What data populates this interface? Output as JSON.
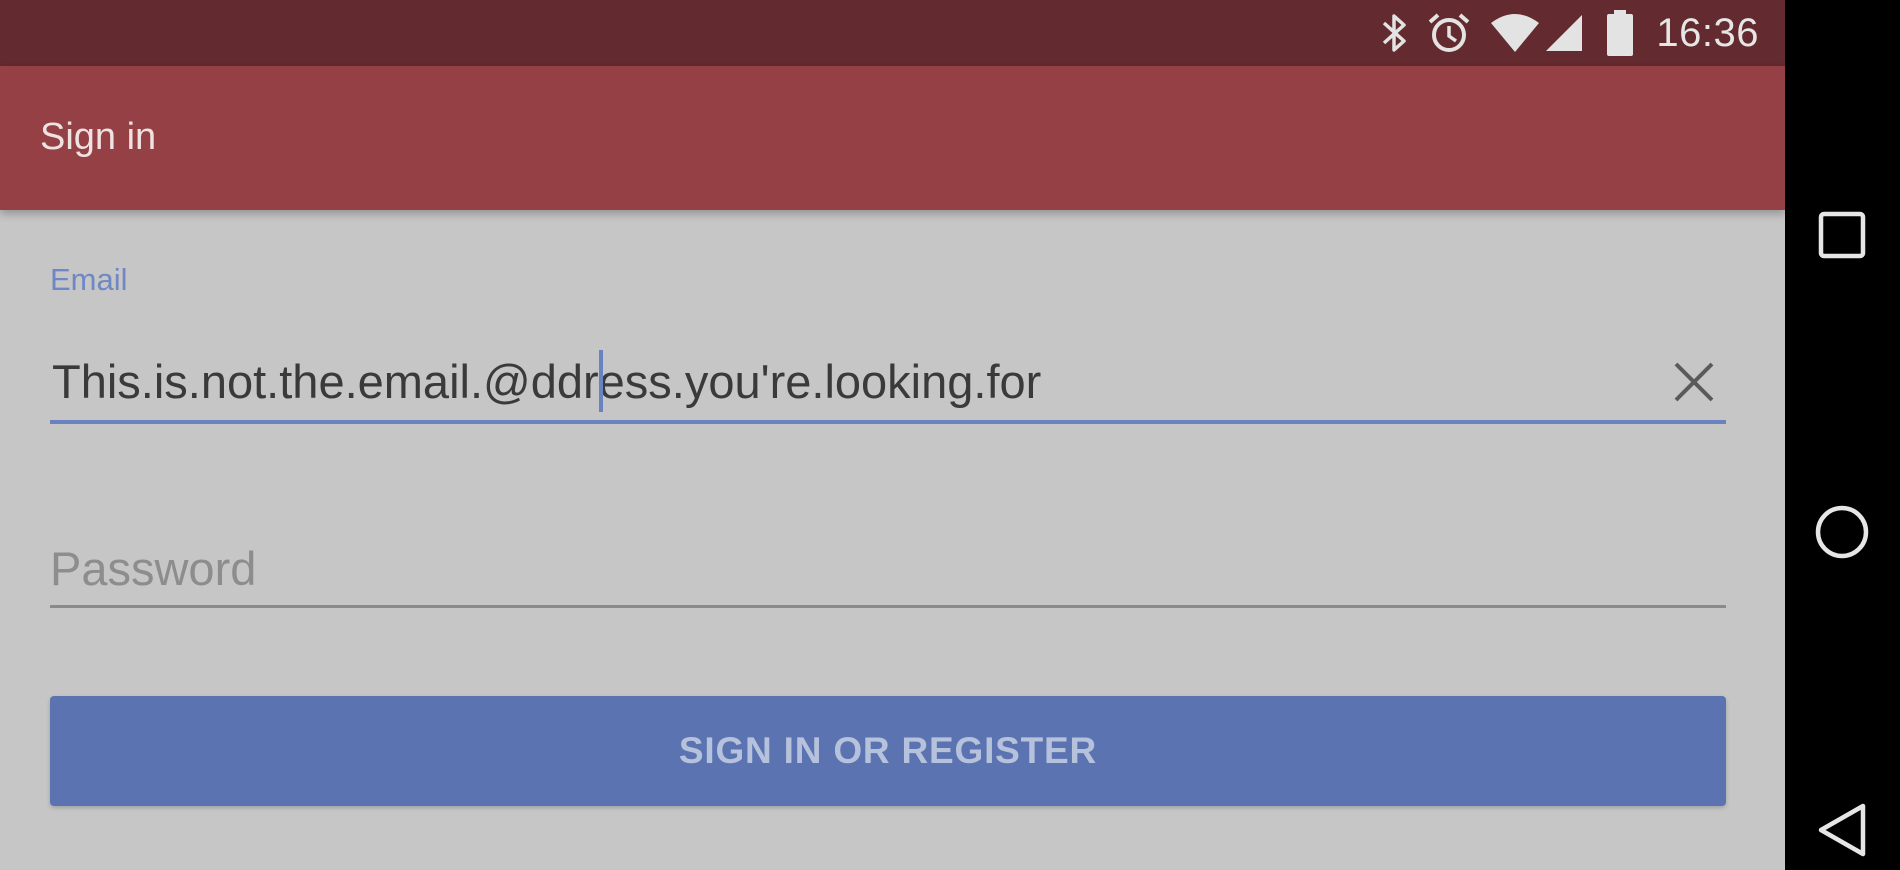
{
  "status_bar": {
    "time": "16:36",
    "icons": [
      "bluetooth-icon",
      "alarm-icon",
      "wifi-icon",
      "cell-signal-icon",
      "battery-icon"
    ]
  },
  "app_bar": {
    "title": "Sign in"
  },
  "form": {
    "email": {
      "label": "Email",
      "value": "This.is.not.the.email.@ddress.you're.looking.for",
      "clear_icon": "close-icon"
    },
    "password": {
      "placeholder": "Password",
      "value": ""
    },
    "submit_label": "SIGN IN OR REGISTER"
  },
  "nav_bar": {
    "buttons": [
      "recents-icon",
      "home-icon",
      "back-icon"
    ]
  },
  "colors": {
    "status_bar": "#632a2f",
    "app_bar": "#954045",
    "accent": "#5b74b1",
    "background": "#c6c6c6"
  }
}
